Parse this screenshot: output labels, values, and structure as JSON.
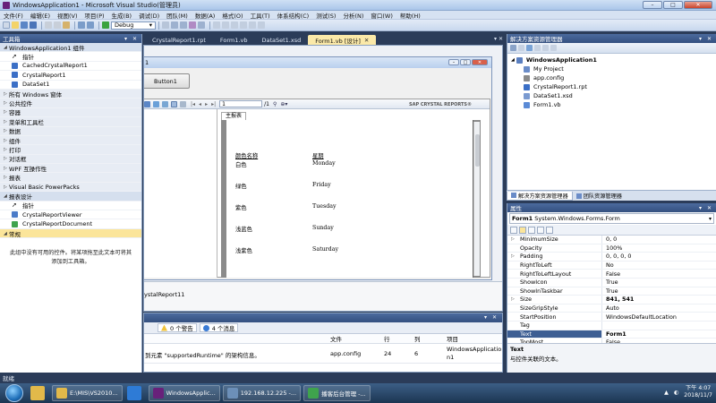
{
  "window": {
    "title": "WindowsApplication1 - Microsoft Visual Studio(管理员)",
    "min": "–",
    "max": "□",
    "close": "✕"
  },
  "menu": [
    "文件(F)",
    "编辑(E)",
    "视图(V)",
    "项目(P)",
    "生成(B)",
    "调试(D)",
    "团队(M)",
    "数据(A)",
    "格式(O)",
    "工具(T)",
    "体系结构(C)",
    "测试(S)",
    "分析(N)",
    "窗口(W)",
    "帮助(H)"
  ],
  "toolbar": {
    "config": "Debug"
  },
  "toolbox": {
    "title": "工具箱",
    "controls": "▾ ✕",
    "items": [
      {
        "label": "WindowsApplication1 组件",
        "kind": "cat-open"
      },
      {
        "label": "指针",
        "kind": "pointer"
      },
      {
        "label": "CachedCrystalReport1",
        "kind": "item",
        "color": "#3b6fc6"
      },
      {
        "label": "CrystalReport1",
        "kind": "item",
        "color": "#3b6fc6"
      },
      {
        "label": "DataSet1",
        "kind": "item",
        "color": "#3b6fc6"
      },
      {
        "label": "所有 Windows 窗体",
        "kind": "cat"
      },
      {
        "label": "公共控件",
        "kind": "cat"
      },
      {
        "label": "容器",
        "kind": "cat"
      },
      {
        "label": "菜单和工具栏",
        "kind": "cat"
      },
      {
        "label": "数据",
        "kind": "cat"
      },
      {
        "label": "组件",
        "kind": "cat"
      },
      {
        "label": "打印",
        "kind": "cat"
      },
      {
        "label": "对话框",
        "kind": "cat"
      },
      {
        "label": "WPF 互操作性",
        "kind": "cat"
      },
      {
        "label": "报表",
        "kind": "cat"
      },
      {
        "label": "Visual Basic PowerPacks",
        "kind": "cat"
      },
      {
        "label": "报表设计",
        "kind": "cat-open"
      },
      {
        "label": "指针",
        "kind": "pointer"
      },
      {
        "label": "CrystalReportViewer",
        "kind": "item",
        "color": "#4a7bc8"
      },
      {
        "label": "CrystalReportDocument",
        "kind": "item",
        "color": "#3fa34d"
      },
      {
        "label": "常规",
        "kind": "sel"
      }
    ],
    "empty_line1": "此组中没有可用的控件。将某项拖至此文本可将其",
    "empty_line2": "添加到工具箱。"
  },
  "doc_tabs": [
    {
      "label": "CrystalReport1.rpt",
      "active": false
    },
    {
      "label": "Form1.vb",
      "active": false
    },
    {
      "label": "DataSet1.xsd",
      "active": false
    },
    {
      "label": "Form1.vb [设计]",
      "active": true
    }
  ],
  "tab_close": "✕",
  "designer": {
    "form_title": "1",
    "button_label": "Button1",
    "viewer": {
      "page_box": "1",
      "page_total": "/1",
      "brand": "SAP CRYSTAL REPORTS®",
      "main_tab": "主报表",
      "col1_header": "颜色名称",
      "col2_header": "星期",
      "rows": [
        {
          "c1": "白色",
          "c2": "Monday"
        },
        {
          "c1": "绿色",
          "c2": "Friday"
        },
        {
          "c1": "紫色",
          "c2": "Tuesday"
        },
        {
          "c1": "浅蓝色",
          "c2": "Sunday"
        },
        {
          "c1": "浅紫色",
          "c2": "Saturday"
        }
      ]
    },
    "tray_item": "ystalReport11"
  },
  "error_list": {
    "controls": "▾ ✕",
    "filter_warnings": "0 个警告",
    "filter_messages": "4 个消息",
    "columns": {
      "file": "文件",
      "line": "行",
      "col": "列",
      "project": "项目"
    },
    "row": {
      "desc": "到元素 \"supportedRuntime\" 的架构信息。",
      "file": "app.config",
      "line": "24",
      "col": "6",
      "project_l1": "WindowsApplicatio",
      "project_l2": "n1"
    }
  },
  "solution": {
    "title": "解决方案资源管理器",
    "controls": "▾ ✕",
    "items": [
      {
        "label": "WindowsApplication1",
        "bold": true,
        "indent": 0,
        "color": "#5a7fc0"
      },
      {
        "label": "My Project",
        "bold": false,
        "indent": 1,
        "color": "#6a8cc8"
      },
      {
        "label": "app.config",
        "bold": false,
        "indent": 1,
        "color": "#8a8a8a"
      },
      {
        "label": "CrystalReport1.rpt",
        "bold": false,
        "indent": 1,
        "color": "#3b6fc6"
      },
      {
        "label": "DataSet1.xsd",
        "bold": false,
        "indent": 1,
        "color": "#7a9ad0"
      },
      {
        "label": "Form1.vb",
        "bold": false,
        "indent": 1,
        "color": "#5b8bd6"
      }
    ],
    "tabs": [
      "解决方案资源管理器",
      "团队资源管理器"
    ]
  },
  "properties": {
    "title": "属性",
    "controls": "▾ ✕",
    "object_name": "Form1",
    "object_type": "System.Windows.Forms.Form",
    "rows": [
      {
        "name": "MinimumSize",
        "value": "0, 0",
        "expand": true,
        "bold": false,
        "sel": false
      },
      {
        "name": "Opacity",
        "value": "100%",
        "expand": false,
        "bold": false,
        "sel": false
      },
      {
        "name": "Padding",
        "value": "0, 0, 0, 0",
        "expand": true,
        "bold": false,
        "sel": false
      },
      {
        "name": "RightToLeft",
        "value": "No",
        "expand": false,
        "bold": false,
        "sel": false
      },
      {
        "name": "RightToLeftLayout",
        "value": "False",
        "expand": false,
        "bold": false,
        "sel": false
      },
      {
        "name": "ShowIcon",
        "value": "True",
        "expand": false,
        "bold": false,
        "sel": false
      },
      {
        "name": "ShowInTaskbar",
        "value": "True",
        "expand": false,
        "bold": false,
        "sel": false
      },
      {
        "name": "Size",
        "value": "841, 541",
        "expand": true,
        "bold": true,
        "sel": false
      },
      {
        "name": "SizeGripStyle",
        "value": "Auto",
        "expand": false,
        "bold": false,
        "sel": false
      },
      {
        "name": "StartPosition",
        "value": "WindowsDefaultLocation",
        "expand": false,
        "bold": false,
        "sel": false
      },
      {
        "name": "Tag",
        "value": "",
        "expand": false,
        "bold": false,
        "sel": false
      },
      {
        "name": "Text",
        "value": "Form1",
        "expand": false,
        "bold": true,
        "sel": true
      },
      {
        "name": "TopMost",
        "value": "False",
        "expand": false,
        "bold": false,
        "sel": false
      }
    ],
    "desc_title": "Text",
    "desc_body": "与控件关联的文本。"
  },
  "status": "就绪",
  "taskbar": {
    "items": [
      {
        "label": "",
        "color": "#e2b94a",
        "pinned": true
      },
      {
        "label": "E:\\MIS\\VS2010...",
        "color": "#e2b94a",
        "pinned": false
      },
      {
        "label": "",
        "color": "#2e7bd6",
        "pinned": true
      },
      {
        "label": "WindowsApplic...",
        "color": "#68217a",
        "pinned": false
      },
      {
        "label": "192.168.12.225 -...",
        "color": "#6c8fb8",
        "pinned": false
      },
      {
        "label": "播客后台管理 -...",
        "color": "#3fa34d",
        "pinned": false
      }
    ],
    "time": "下午 4:07",
    "date": "2018/11/7"
  }
}
